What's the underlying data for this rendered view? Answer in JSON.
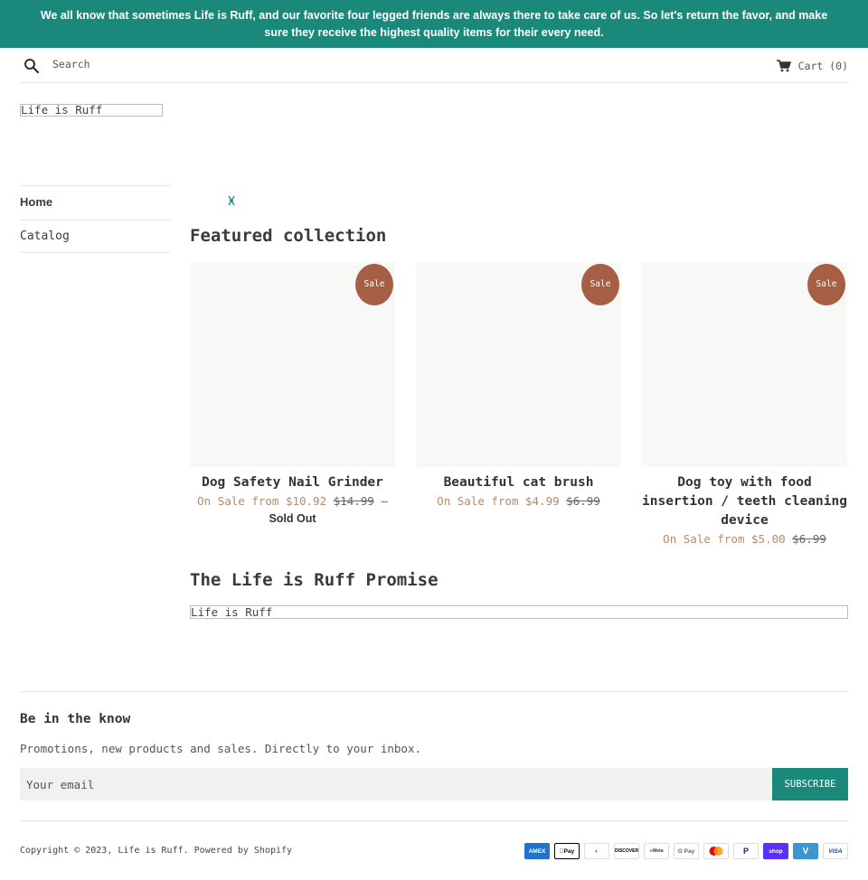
{
  "announcement": {
    "text": "We all know that sometimes Life is Ruff, and our favorite four legged friends are always there to take care of us. So let's return the favor, and make sure they receive the highest quality items for their every need."
  },
  "header": {
    "search_placeholder": "Search",
    "cart_label": "Cart (0)",
    "logo_text": "Life is Ruff"
  },
  "nav": {
    "items": [
      {
        "label": "Home",
        "active": true
      },
      {
        "label": "Catalog",
        "active": false
      }
    ]
  },
  "featured": {
    "title": "Featured collection",
    "products": [
      {
        "title": "Dog Safety Nail Grinder",
        "badge": "Sale",
        "price_prefix": "On Sale from $10.92",
        "old_price": "$14.99",
        "dash": "—",
        "status": "Sold Out"
      },
      {
        "title": "Beautiful cat brush",
        "badge": "Sale",
        "price_prefix": "On Sale from $4.99",
        "old_price": "$6.99"
      },
      {
        "title": "Dog toy with food insertion / teeth cleaning device",
        "badge": "Sale",
        "price_prefix": "On Sale from $5.00",
        "old_price": "$6.99"
      }
    ]
  },
  "promise": {
    "title": "The Life is Ruff Promise",
    "image_alt": "Life is Ruff"
  },
  "newsletter": {
    "title": "Be in the know",
    "subtitle": "Promotions, new products and sales. Directly to your inbox.",
    "email_placeholder": "Your email",
    "button_label": "SUBSCRIBE"
  },
  "footer": {
    "copyright": "Copyright © 2023, Life is Ruff. Powered by Shopify",
    "payment_icons": [
      "amex-icon",
      "apple-pay-icon",
      "diners-club-icon",
      "discover-icon",
      "meta-pay-icon",
      "google-pay-icon",
      "mastercard-icon",
      "paypal-icon",
      "shop-pay-icon",
      "venmo-icon",
      "visa-icon"
    ]
  },
  "colors": {
    "brand": "#1a887a",
    "sale_badge": "#a65f45",
    "sale_price": "#b38b6d"
  }
}
